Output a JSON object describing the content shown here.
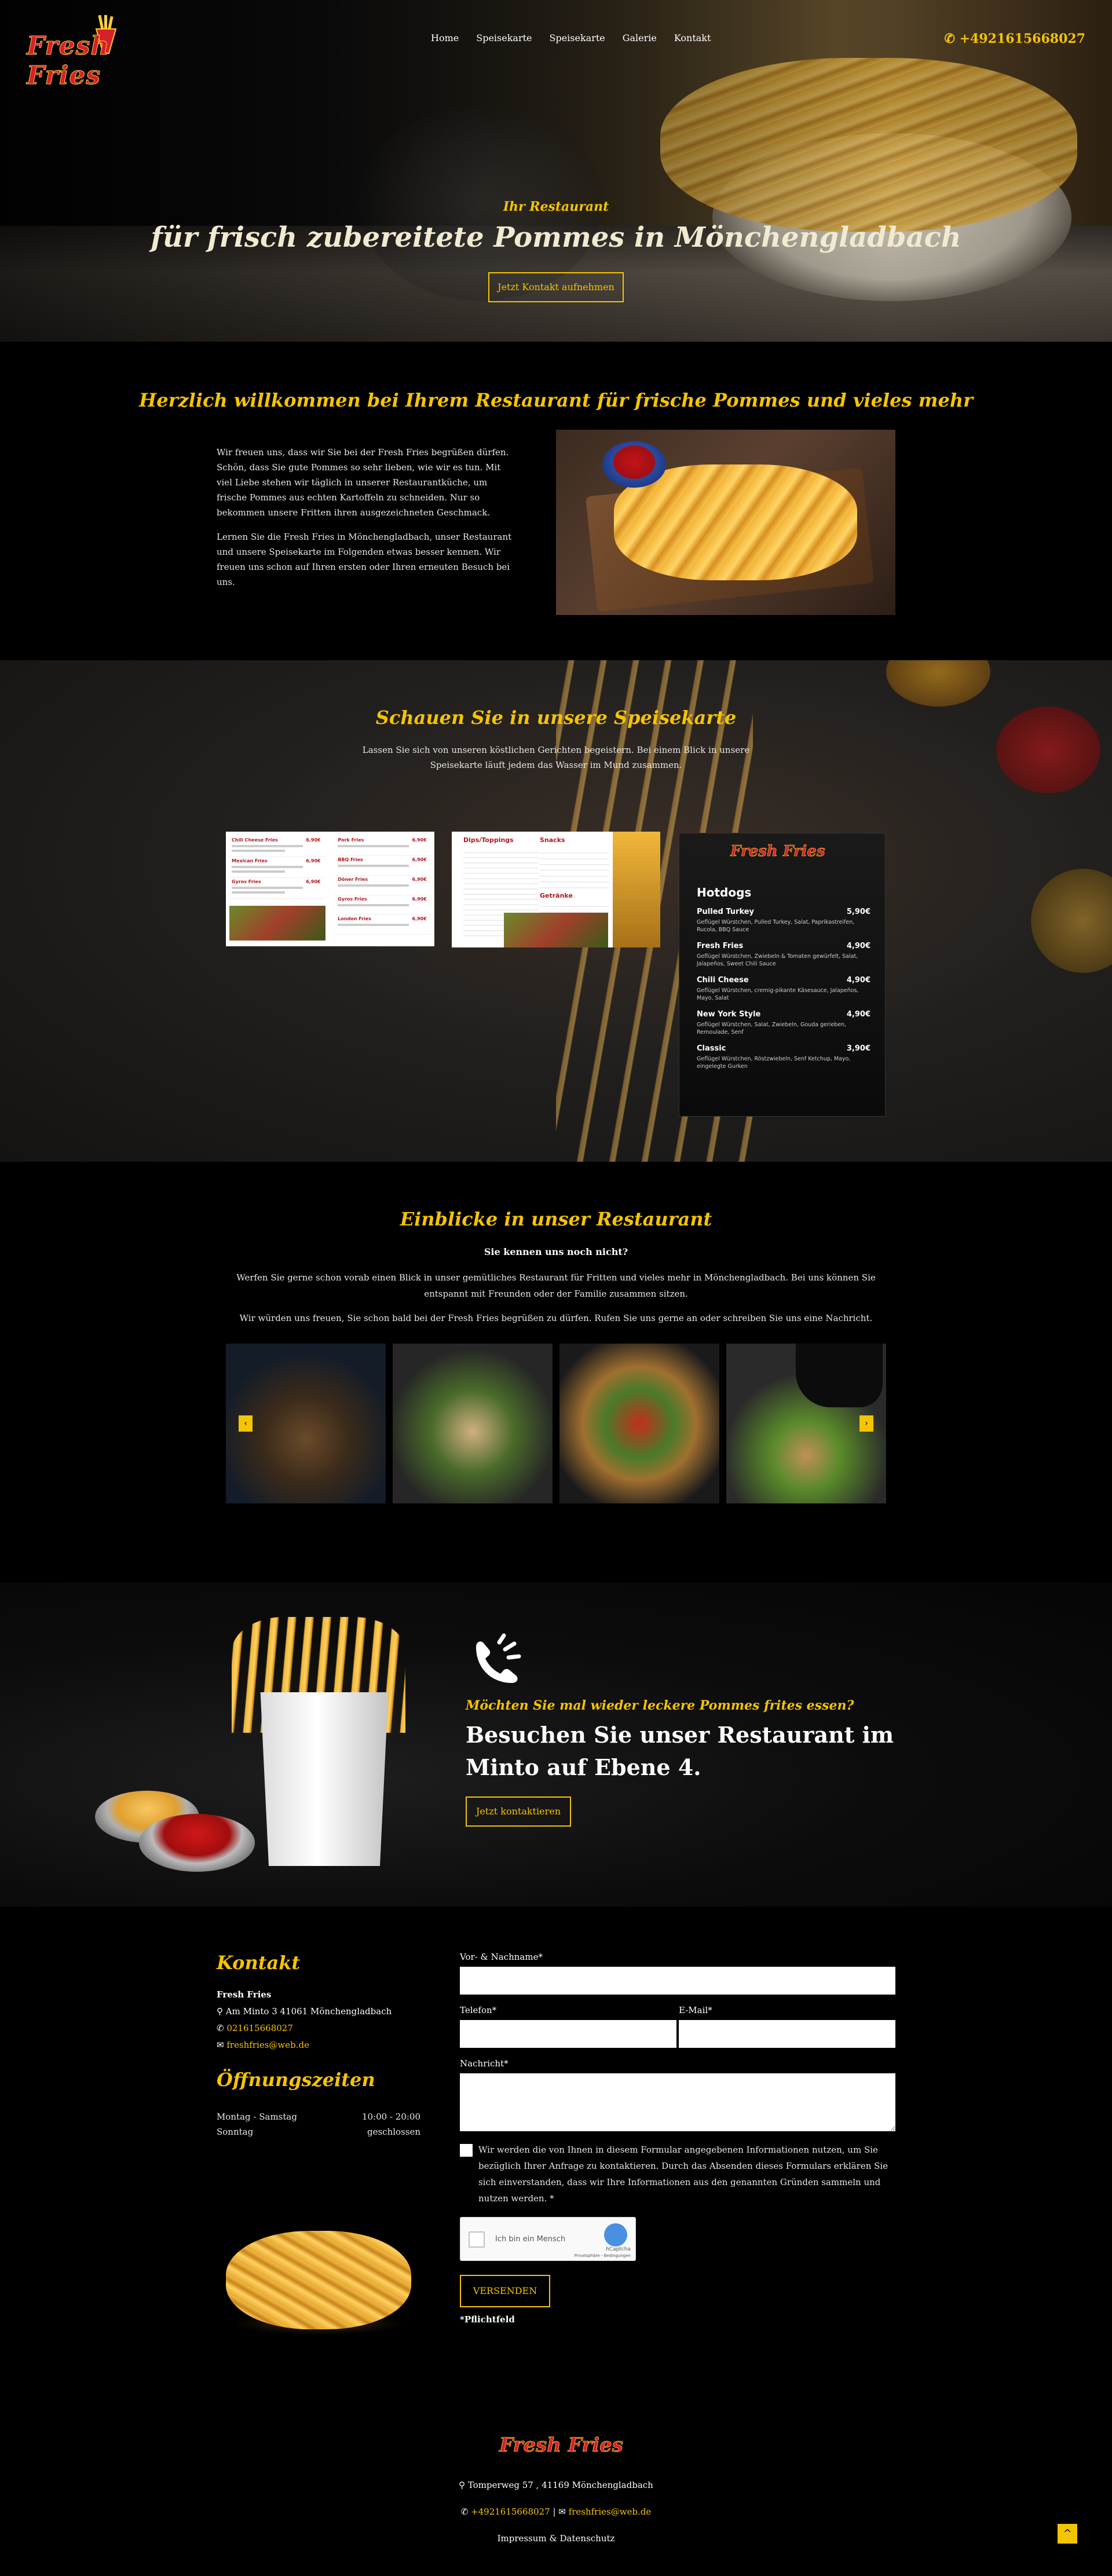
{
  "brand": {
    "logo_text": "Fresh Fries"
  },
  "nav": {
    "items": [
      {
        "label": "Home"
      },
      {
        "label": "Speisekarte"
      },
      {
        "label": "Speisekarte"
      },
      {
        "label": "Galerie"
      },
      {
        "label": "Kontakt"
      }
    ],
    "phone": "+4921615668027"
  },
  "hero": {
    "kicker": "Ihr Restaurant",
    "title": "für frisch zubereitete Pommes in Mönchengladbach",
    "button": "Jetzt Kontakt aufnehmen"
  },
  "welcome": {
    "title": "Herzlich willkommen bei Ihrem Restaurant für frische Pommes und vieles mehr",
    "p1": "Wir freuen uns, dass wir Sie bei der Fresh Fries begrüßen dürfen. Schön, dass Sie gute Pommes so sehr lieben, wie wir es tun. Mit viel Liebe stehen wir täglich in unserer Restaurantküche, um frische Pommes aus echten Kartoffeln zu schneiden. Nur so bekommen unsere Fritten ihren ausgezeichneten Geschmack.",
    "p2": "Lernen Sie die Fresh Fries in Mönchengladbach, unser Restaurant und unsere Speisekarte im Folgenden etwas besser kennen. Wir freuen uns schon auf Ihren ersten oder Ihren erneuten Besuch bei uns."
  },
  "menu": {
    "title": "Schauen Sie in unsere Speisekarte",
    "intro": "Lassen Sie sich von unseren köstlichen Gerichten begeistern. Bei einem Blick in unsere Speisekarte läuft jedem das Wasser im Mund zusammen.",
    "card1": {
      "left": [
        {
          "name": "Chili Cheese Fries",
          "price": "6,90€"
        },
        {
          "name": "Mexican Fries",
          "price": "6,90€"
        },
        {
          "name": "Gyros Fries",
          "price": "6,90€"
        }
      ],
      "right": [
        {
          "name": "Pork Fries",
          "price": "6,90€"
        },
        {
          "name": "BBQ Fries",
          "price": "6,90€"
        },
        {
          "name": "Döner Fries",
          "price": "6,90€"
        },
        {
          "name": "Gyros Fries",
          "price": "6,90€"
        },
        {
          "name": "London Fries",
          "price": "6,90€"
        }
      ]
    },
    "card2": {
      "left_head": "Dips/Toppings",
      "right_head": "Snacks",
      "right_head2": "Getränke"
    },
    "hotdog": {
      "logo": "Fresh Fries",
      "title": "Hotdogs",
      "items": [
        {
          "name": "Pulled Turkey",
          "price": "5,90€",
          "desc": "Geflügel Würstchen, Pulled Turkey, Salat, Paprikastreifen, Rucola, BBQ Sauce"
        },
        {
          "name": "Fresh  Fries",
          "price": "4,90€",
          "desc": "Geflügel Würstchen, Zwiebeln & Tomaten gewürfelt, Salat, Jalapeños, Sweet Chili Sauce"
        },
        {
          "name": "Chili Cheese",
          "price": "4,90€",
          "desc": "Geflügel Würstchen, cremig-pikante Käsesauce, Jalapeños, Mayo, Salat"
        },
        {
          "name": "New York Style",
          "price": "4,90€",
          "desc": "Geflügel Würstchen, Salat, Zwiebeln, Gouda gerieben, Remoulade, Senf"
        },
        {
          "name": "Classic",
          "price": "3,90€",
          "desc": "Geflügel Würstchen, Röstzwiebeln, Senf Ketchup, Mayo, eingelegte Gurken"
        }
      ]
    }
  },
  "insights": {
    "title": "Einblicke in unser Restaurant",
    "subtitle": "Sie kennen uns noch nicht?",
    "p1": "Werfen Sie gerne schon vorab einen Blick in unser gemütliches Restaurant für Fritten und vieles mehr in Mönchengladbach. Bei uns können Sie entspannt mit Freunden oder der Familie zusammen sitzen.",
    "p2": "Wir würden uns freuen, Sie schon bald bei der Fresh Fries begrüßen zu dürfen. Rufen Sie uns gerne an oder schreiben Sie uns eine Nachricht.",
    "prev": "‹",
    "next": "›"
  },
  "cta": {
    "question": "Möchten Sie mal wieder leckere Pommes frites essen?",
    "headline": "Besuchen Sie unser Restaurant im Minto auf Ebene 4.",
    "button": "Jetzt kontaktieren"
  },
  "contact": {
    "title": "Kontakt",
    "name": "Fresh Fries",
    "address": "Am Minto 3 41061 Mönchengladbach",
    "phone": "021615668027",
    "email": "freshfries@web.de",
    "hours_title": "Öffnungszeiten",
    "hours": [
      {
        "day": "Montag - Samstag",
        "time": "10:00 - 20:00"
      },
      {
        "day": "Sonntag",
        "time": "geschlossen"
      }
    ]
  },
  "form": {
    "name_label": "Vor- & Nachname*",
    "phone_label": "Telefon*",
    "email_label": "E-Mail*",
    "message_label": "Nachricht*",
    "consent": "Wir werden die von Ihnen in diesem Formular angegebenen Informationen nutzen, um Sie bezüglich Ihrer Anfrage zu kontaktieren. Durch das Absenden dieses Formulars erklären Sie sich einverstanden, dass wir Ihre Informationen aus den genannten Gründen sammeln und nutzen werden. *",
    "captcha_text": "Ich bin ein Mensch",
    "captcha_brand": "hCaptcha",
    "captcha_terms": "Privatsphäre - Bedingungen",
    "submit": "VERSENDEN",
    "required_note": "*Pflichtfeld"
  },
  "footer": {
    "logo": "Fresh Fries",
    "address": "Tomperweg 57 , 41169 Mönchengladbach",
    "phone": "+4921615668027",
    "email": "freshfries@web.de",
    "legal": "Impressum & Datenschutz",
    "to_top": "^"
  },
  "colors": {
    "accent": "#f5c400",
    "brand_red": "#d6202a",
    "background": "#000000"
  }
}
